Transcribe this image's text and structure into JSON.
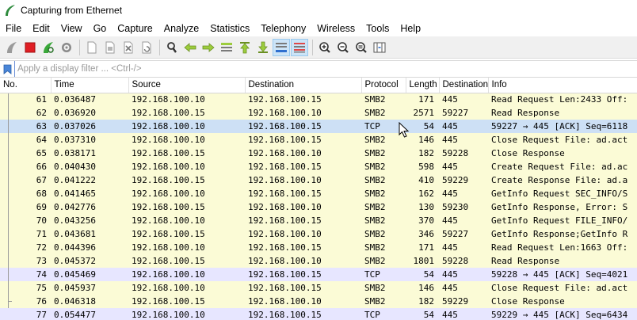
{
  "window": {
    "title": "Capturing from Ethernet"
  },
  "menu": [
    "File",
    "Edit",
    "View",
    "Go",
    "Capture",
    "Analyze",
    "Statistics",
    "Telephony",
    "Wireless",
    "Tools",
    "Help"
  ],
  "filter": {
    "placeholder": "Apply a display filter ... <Ctrl-/>"
  },
  "columns": [
    "No.",
    "Time",
    "Source",
    "Destination",
    "Protocol",
    "Length",
    "Destination",
    "Info"
  ],
  "rows": [
    {
      "no": "61",
      "time": "0.036487",
      "src": "192.168.100.10",
      "dst": "192.168.100.15",
      "proto": "SMB2",
      "len": "171",
      "dport": "445",
      "info": "Read Request Len:2433 Off:"
    },
    {
      "no": "62",
      "time": "0.036920",
      "src": "192.168.100.15",
      "dst": "192.168.100.10",
      "proto": "SMB2",
      "len": "2571",
      "dport": "59227",
      "info": "Read Response"
    },
    {
      "no": "63",
      "time": "0.037026",
      "src": "192.168.100.10",
      "dst": "192.168.100.15",
      "proto": "TCP",
      "len": "54",
      "dport": "445",
      "info": "59227 → 445 [ACK] Seq=6118"
    },
    {
      "no": "64",
      "time": "0.037310",
      "src": "192.168.100.10",
      "dst": "192.168.100.15",
      "proto": "SMB2",
      "len": "146",
      "dport": "445",
      "info": "Close Request File: ad.act"
    },
    {
      "no": "65",
      "time": "0.038171",
      "src": "192.168.100.15",
      "dst": "192.168.100.10",
      "proto": "SMB2",
      "len": "182",
      "dport": "59228",
      "info": "Close Response"
    },
    {
      "no": "66",
      "time": "0.040430",
      "src": "192.168.100.10",
      "dst": "192.168.100.15",
      "proto": "SMB2",
      "len": "598",
      "dport": "445",
      "info": "Create Request File: ad.ac"
    },
    {
      "no": "67",
      "time": "0.041222",
      "src": "192.168.100.15",
      "dst": "192.168.100.10",
      "proto": "SMB2",
      "len": "410",
      "dport": "59229",
      "info": "Create Response File: ad.a"
    },
    {
      "no": "68",
      "time": "0.041465",
      "src": "192.168.100.10",
      "dst": "192.168.100.15",
      "proto": "SMB2",
      "len": "162",
      "dport": "445",
      "info": "GetInfo Request SEC_INFO/S"
    },
    {
      "no": "69",
      "time": "0.042776",
      "src": "192.168.100.15",
      "dst": "192.168.100.10",
      "proto": "SMB2",
      "len": "130",
      "dport": "59230",
      "info": "GetInfo Response, Error: S"
    },
    {
      "no": "70",
      "time": "0.043256",
      "src": "192.168.100.10",
      "dst": "192.168.100.15",
      "proto": "SMB2",
      "len": "370",
      "dport": "445",
      "info": "GetInfo Request FILE_INFO/"
    },
    {
      "no": "71",
      "time": "0.043681",
      "src": "192.168.100.15",
      "dst": "192.168.100.10",
      "proto": "SMB2",
      "len": "346",
      "dport": "59227",
      "info": "GetInfo Response;GetInfo R"
    },
    {
      "no": "72",
      "time": "0.044396",
      "src": "192.168.100.10",
      "dst": "192.168.100.15",
      "proto": "SMB2",
      "len": "171",
      "dport": "445",
      "info": "Read Request Len:1663 Off:"
    },
    {
      "no": "73",
      "time": "0.045372",
      "src": "192.168.100.15",
      "dst": "192.168.100.10",
      "proto": "SMB2",
      "len": "1801",
      "dport": "59228",
      "info": "Read Response"
    },
    {
      "no": "74",
      "time": "0.045469",
      "src": "192.168.100.10",
      "dst": "192.168.100.15",
      "proto": "TCP",
      "len": "54",
      "dport": "445",
      "info": "59228 → 445 [ACK] Seq=4021"
    },
    {
      "no": "75",
      "time": "0.045937",
      "src": "192.168.100.10",
      "dst": "192.168.100.15",
      "proto": "SMB2",
      "len": "146",
      "dport": "445",
      "info": "Close Request File: ad.act"
    },
    {
      "no": "76",
      "time": "0.046318",
      "src": "192.168.100.15",
      "dst": "192.168.100.10",
      "proto": "SMB2",
      "len": "182",
      "dport": "59229",
      "info": "Close Response"
    },
    {
      "no": "77",
      "time": "0.054477",
      "src": "192.168.100.10",
      "dst": "192.168.100.15",
      "proto": "TCP",
      "len": "54",
      "dport": "445",
      "info": "59229 → 445 [ACK] Seq=6434"
    }
  ],
  "selected_row": "63",
  "colors": {
    "smb2_row": "#fbfbd6",
    "tcp_row": "#e7e6ff",
    "selected_row": "#cde0f5",
    "capture_stop": "#e01e24",
    "shark_fin": "#3aa83a"
  }
}
